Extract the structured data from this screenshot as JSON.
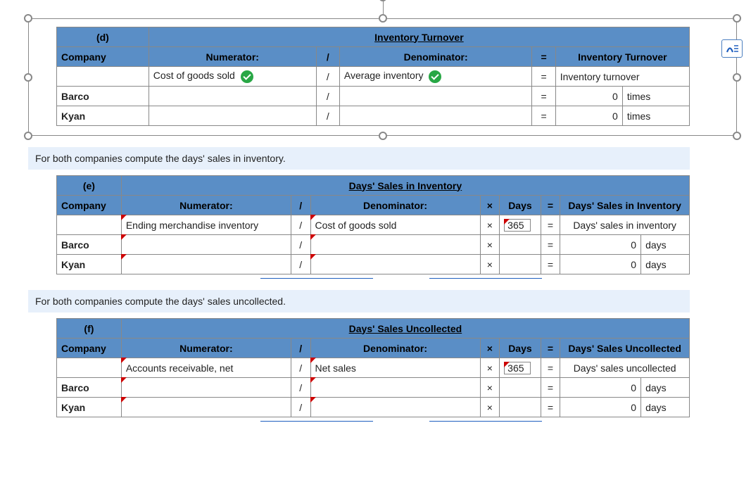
{
  "icons": {
    "tool": "text-style-icon"
  },
  "tableD": {
    "tag": "(d)",
    "title": "Inventory Turnover",
    "headers": {
      "company": "Company",
      "numerator": "Numerator:",
      "slash": "/",
      "denominator": "Denominator:",
      "eq": "=",
      "result": "Inventory Turnover"
    },
    "row0": {
      "numerator": "Cost of goods sold",
      "slash": "/",
      "denominator": "Average inventory",
      "eq": "=",
      "result": "Inventory turnover"
    },
    "rows": [
      {
        "company": "Barco",
        "slash": "/",
        "eq": "=",
        "value": "0",
        "unit": "times"
      },
      {
        "company": "Kyan",
        "slash": "/",
        "eq": "=",
        "value": "0",
        "unit": "times"
      }
    ]
  },
  "promptE": "For both companies compute the days' sales in inventory.",
  "tableE": {
    "tag": "(e)",
    "title": "Days' Sales in Inventory",
    "headers": {
      "company": "Company",
      "numerator": "Numerator:",
      "slash": "/",
      "denominator": "Denominator:",
      "x": "×",
      "days": "Days",
      "eq": "=",
      "result": "Days' Sales in Inventory"
    },
    "row0": {
      "numerator": "Ending merchandise inventory",
      "slash": "/",
      "denominator": "Cost of goods sold",
      "x": "×",
      "days": "365",
      "eq": "=",
      "result": "Days' sales in inventory"
    },
    "rows": [
      {
        "company": "Barco",
        "slash": "/",
        "x": "×",
        "eq": "=",
        "value": "0",
        "unit": "days"
      },
      {
        "company": "Kyan",
        "slash": "/",
        "x": "×",
        "eq": "=",
        "value": "0",
        "unit": "days"
      }
    ]
  },
  "promptF": "For both companies compute the days' sales uncollected.",
  "tableF": {
    "tag": "(f)",
    "title": "Days' Sales Uncollected",
    "headers": {
      "company": "Company",
      "numerator": "Numerator:",
      "slash": "/",
      "denominator": "Denominator:",
      "x": "×",
      "days": "Days",
      "eq": "=",
      "result": "Days' Sales Uncollected"
    },
    "row0": {
      "numerator": "Accounts receivable, net",
      "slash": "/",
      "denominator": "Net sales",
      "x": "×",
      "days": "365",
      "eq": "=",
      "result": "Days' sales uncollected"
    },
    "rows": [
      {
        "company": "Barco",
        "slash": "/",
        "x": "×",
        "eq": "=",
        "value": "0",
        "unit": "days"
      },
      {
        "company": "Kyan",
        "slash": "/",
        "x": "×",
        "eq": "=",
        "value": "0",
        "unit": "days"
      }
    ]
  }
}
